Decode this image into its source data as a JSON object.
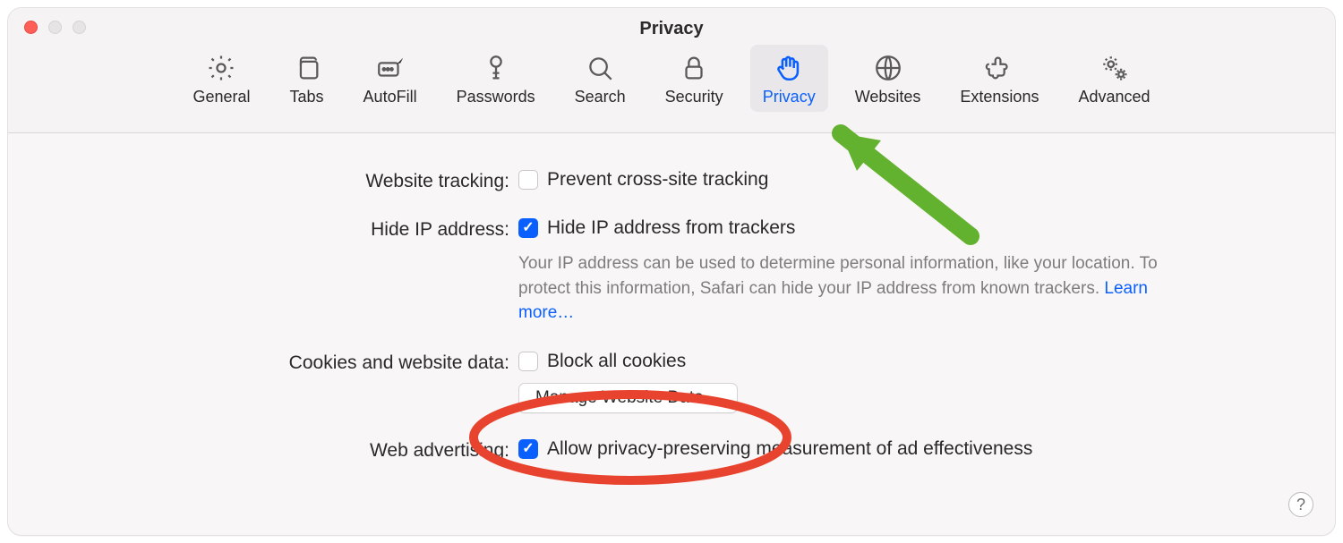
{
  "window": {
    "title": "Privacy"
  },
  "tabs": [
    {
      "id": "general",
      "label": "General",
      "icon": "gear-icon",
      "active": false
    },
    {
      "id": "tabs",
      "label": "Tabs",
      "icon": "tabs-icon",
      "active": false
    },
    {
      "id": "autofill",
      "label": "AutoFill",
      "icon": "pencil-icon",
      "active": false
    },
    {
      "id": "passwords",
      "label": "Passwords",
      "icon": "key-icon",
      "active": false
    },
    {
      "id": "search",
      "label": "Search",
      "icon": "search-icon",
      "active": false
    },
    {
      "id": "security",
      "label": "Security",
      "icon": "lock-icon",
      "active": false
    },
    {
      "id": "privacy",
      "label": "Privacy",
      "icon": "hand-icon",
      "active": true
    },
    {
      "id": "websites",
      "label": "Websites",
      "icon": "globe-icon",
      "active": false
    },
    {
      "id": "extensions",
      "label": "Extensions",
      "icon": "puzzle-icon",
      "active": false
    },
    {
      "id": "advanced",
      "label": "Advanced",
      "icon": "gears-icon",
      "active": false
    }
  ],
  "settings": {
    "website_tracking": {
      "label": "Website tracking:",
      "option_label": "Prevent cross-site tracking",
      "checked": false
    },
    "hide_ip": {
      "label": "Hide IP address:",
      "option_label": "Hide IP address from trackers",
      "checked": true,
      "description": "Your IP address can be used to determine personal information, like your location. To protect this information, Safari can hide your IP address from known trackers.",
      "learn_more": "Learn more…"
    },
    "cookies": {
      "label": "Cookies and website data:",
      "option_label": "Block all cookies",
      "checked": false,
      "button": "Manage Website Data…"
    },
    "web_ads": {
      "label": "Web advertising:",
      "option_label": "Allow privacy-preserving measurement of ad effectiveness",
      "checked": true
    }
  },
  "help_glyph": "?"
}
